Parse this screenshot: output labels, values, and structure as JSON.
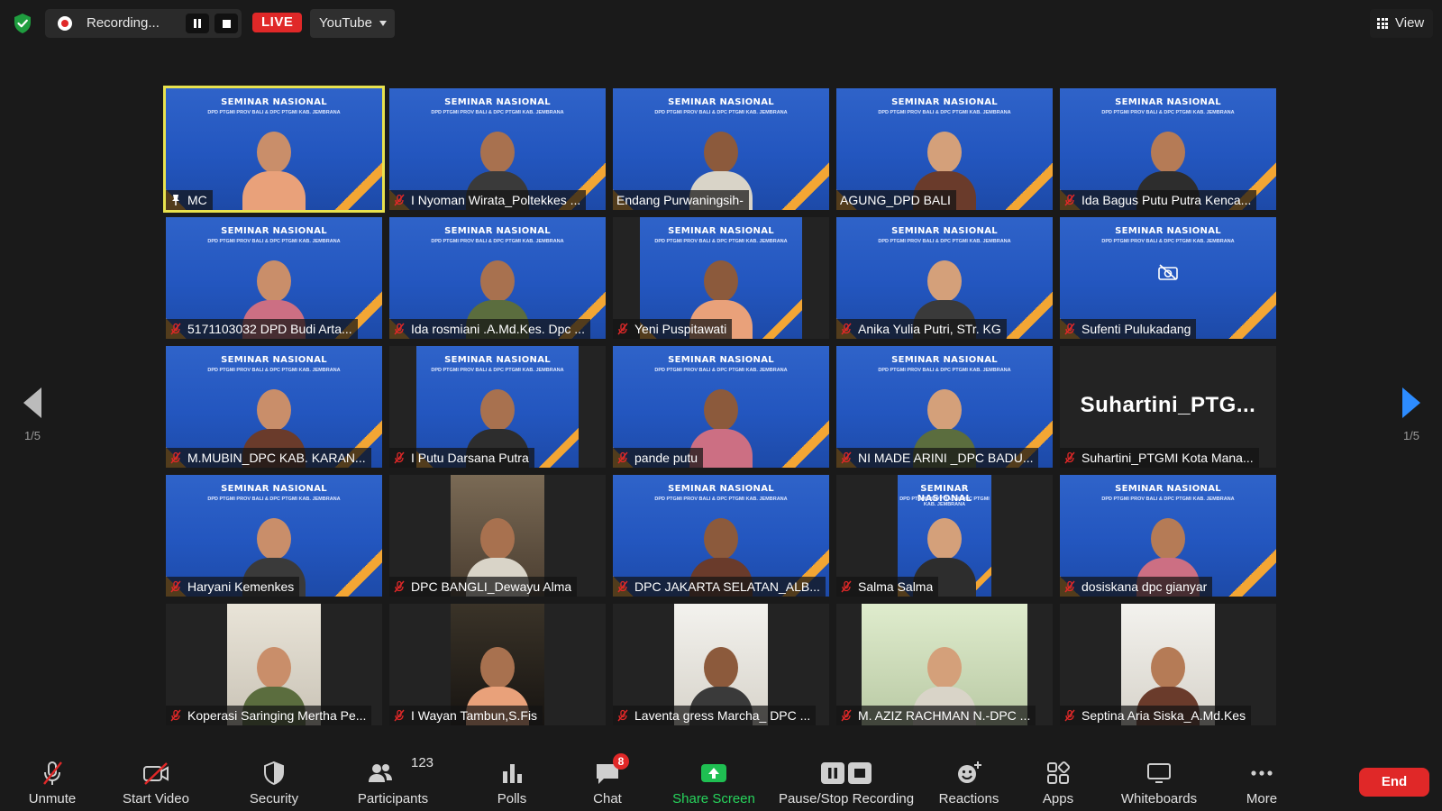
{
  "top_bar": {
    "recording_text": "Recording...",
    "live_label": "LIVE",
    "stream_target": "YouTube",
    "view_label": "View"
  },
  "pagination": {
    "left": "1/5",
    "right": "1/5"
  },
  "banner": {
    "title": "SEMINAR NASIONAL",
    "subtitle": "DPD PTGMI PROV BALI & DPC PTGMI KAB. JEMBRANA"
  },
  "participants": [
    {
      "name": "MC",
      "video": "banner",
      "muted": false,
      "pinned": true,
      "active": true,
      "frame": "full"
    },
    {
      "name": "I Nyoman Wirata_Poltekkes ...",
      "video": "banner",
      "muted": true,
      "frame": "full"
    },
    {
      "name": "Endang Purwaningsih-",
      "video": "banner",
      "muted": false,
      "frame": "full"
    },
    {
      "name": "AGUNG_DPD BALI",
      "video": "banner",
      "muted": false,
      "frame": "full"
    },
    {
      "name": "Ida Bagus Putu Putra Kenca...",
      "video": "banner",
      "muted": true,
      "frame": "full"
    },
    {
      "name": "5171103032 DPD  Budi Arta...",
      "video": "banner",
      "muted": true,
      "frame": "full"
    },
    {
      "name": "Ida rosmiani .A.Md.Kes. Dpc ...",
      "video": "banner",
      "muted": true,
      "frame": "full"
    },
    {
      "name": "Yeni Puspitawati",
      "video": "banner",
      "muted": true,
      "frame": "mid"
    },
    {
      "name": "Anika Yulia Putri, STr. KG",
      "video": "banner",
      "muted": true,
      "frame": "full"
    },
    {
      "name": "Sufenti Pulukadang",
      "video": "banner",
      "muted": true,
      "frame": "full",
      "camera_off": true
    },
    {
      "name": "M.MUBIN_DPC KAB. KARAN...",
      "video": "banner",
      "muted": true,
      "frame": "full"
    },
    {
      "name": "I Putu Darsana Putra",
      "video": "banner",
      "muted": true,
      "frame": "mid"
    },
    {
      "name": "pande putu",
      "video": "banner",
      "muted": true,
      "frame": "full"
    },
    {
      "name": "NI MADE ARINI _DPC BADU...",
      "video": "banner",
      "muted": true,
      "frame": "full"
    },
    {
      "name": "Suhartini_PTGMI Kota Mana...",
      "video": "none",
      "muted": true,
      "frame": "full",
      "display_name": "Suhartini_PTG..."
    },
    {
      "name": "Haryani Kemenkes",
      "video": "banner",
      "muted": true,
      "frame": "full"
    },
    {
      "name": "DPC BANGLI_Dewayu Alma",
      "video": "room",
      "muted": true,
      "frame": "narrow"
    },
    {
      "name": "DPC JAKARTA SELATAN_ALB...",
      "video": "banner",
      "muted": true,
      "frame": "full"
    },
    {
      "name": "Salma Salma",
      "video": "banner",
      "muted": true,
      "frame": "narrow"
    },
    {
      "name": "dosiskana dpc gianyar",
      "video": "banner",
      "muted": true,
      "frame": "full"
    },
    {
      "name": "Koperasi Saringing Mertha Pe...",
      "video": "light",
      "muted": true,
      "frame": "narrow"
    },
    {
      "name": "I Wayan Tambun,S.Fis",
      "video": "dark",
      "muted": true,
      "frame": "narrow"
    },
    {
      "name": "Laventa gress Marcha_ DPC ...",
      "video": "white",
      "muted": true,
      "frame": "narrow"
    },
    {
      "name": "M. AZIZ RACHMAN N.-DPC ...",
      "video": "green",
      "muted": true,
      "frame": "wide"
    },
    {
      "name": "Septina Aria Siska_A.Md.Kes",
      "video": "white",
      "muted": true,
      "frame": "narrow"
    }
  ],
  "toolbar": {
    "unmute": "Unmute",
    "start_video": "Start Video",
    "security": "Security",
    "participants": "Participants",
    "participants_count": "123",
    "polls": "Polls",
    "chat": "Chat",
    "chat_badge": "8",
    "share_screen": "Share Screen",
    "pause_stop_recording": "Pause/Stop Recording",
    "reactions": "Reactions",
    "apps": "Apps",
    "whiteboards": "Whiteboards",
    "more": "More",
    "end": "End"
  },
  "colors": {
    "accent_blue": "#2d8cff",
    "live_red": "#e02828",
    "active_speaker": "#e8e24e",
    "share_green": "#27d45c"
  }
}
